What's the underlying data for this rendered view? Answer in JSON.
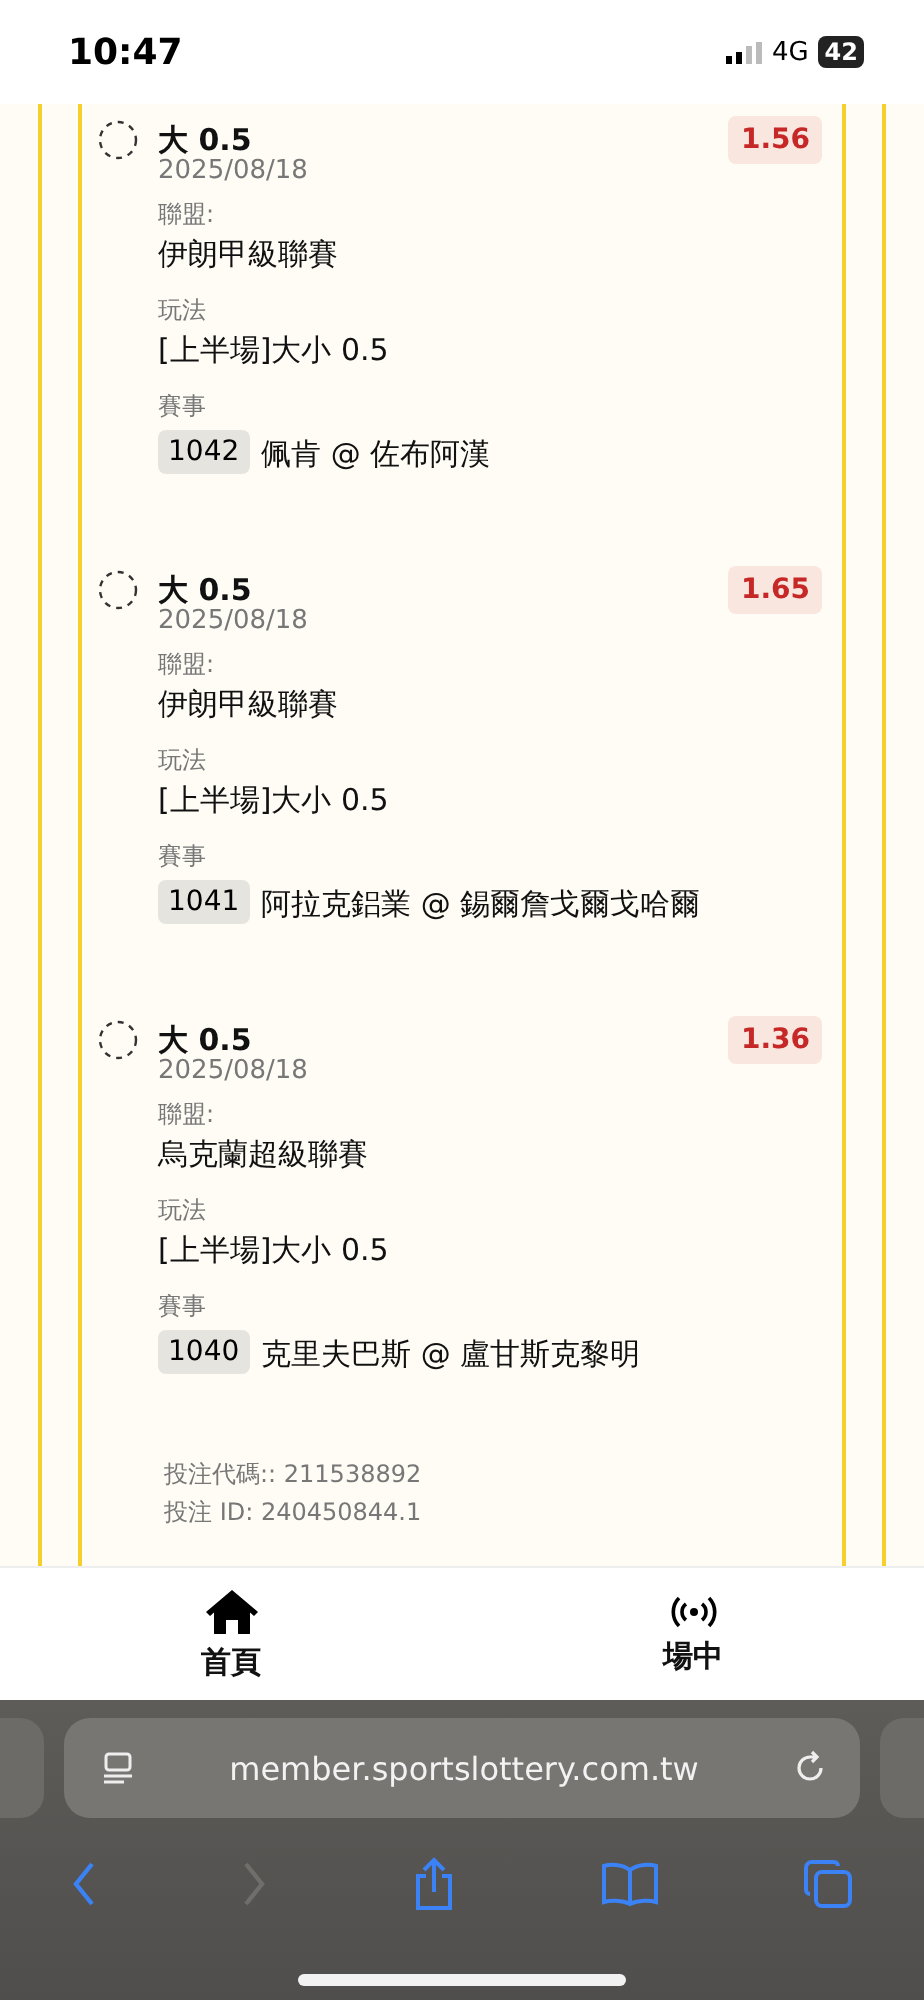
{
  "status_bar": {
    "time": "10:47",
    "network": "4G",
    "battery": "42"
  },
  "bets": [
    {
      "selection": "大 0.5",
      "date": "2025/08/18",
      "odds": "1.56",
      "league_label": "聯盟:",
      "league": "伊朗甲級聯賽",
      "market_label": "玩法",
      "market": "[上半場]大小 0.5",
      "event_label": "賽事",
      "event_code": "1042",
      "event": "佩肯 @ 佐布阿漢"
    },
    {
      "selection": "大 0.5",
      "date": "2025/08/18",
      "odds": "1.65",
      "league_label": "聯盟:",
      "league": "伊朗甲級聯賽",
      "market_label": "玩法",
      "market": "[上半場]大小 0.5",
      "event_label": "賽事",
      "event_code": "1041",
      "event": "阿拉克鋁業 @ 錫爾詹戈爾戈哈爾"
    },
    {
      "selection": "大 0.5",
      "date": "2025/08/18",
      "odds": "1.36",
      "league_label": "聯盟:",
      "league": "烏克蘭超級聯賽",
      "market_label": "玩法",
      "market": "[上半場]大小 0.5",
      "event_label": "賽事",
      "event_code": "1040",
      "event": "克里夫巴斯 @ 盧甘斯克黎明"
    }
  ],
  "bet_codes": [
    "投注代碼:: 211538892",
    "投注 ID: 240450844.1"
  ],
  "tab_bar": [
    {
      "kind": "home",
      "label": "首頁"
    },
    {
      "kind": "live",
      "label": "場中"
    }
  ],
  "browser": {
    "url": "member.sportslottery.com.tw",
    "nav": [
      {
        "kind": "back",
        "disabled": false
      },
      {
        "kind": "forward",
        "disabled": true
      },
      {
        "kind": "share",
        "disabled": false
      },
      {
        "kind": "bookmarks",
        "disabled": false
      },
      {
        "kind": "tabs",
        "disabled": false
      }
    ]
  }
}
